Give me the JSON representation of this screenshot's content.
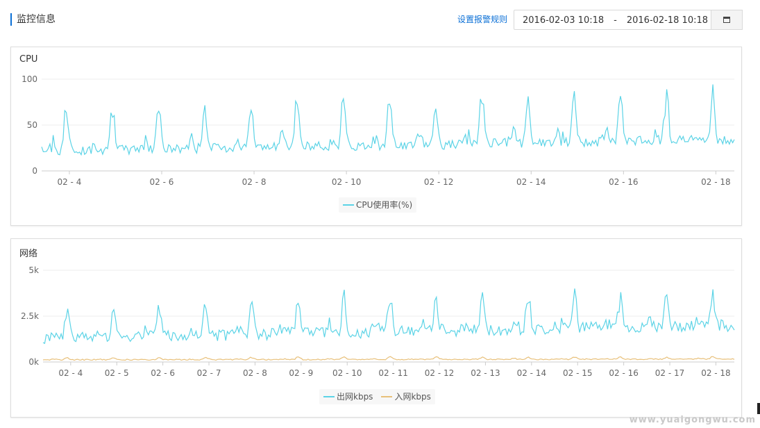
{
  "header": {
    "title": "监控信息",
    "alert_rules_link": "设置报警规则",
    "date_from": "2016-02-03 10:18",
    "date_sep": "-",
    "date_to": "2016-02-18 10:18",
    "calendar_icon": "calendar-icon",
    "accent_color": "#0a6fd6"
  },
  "watermark": "www.yuaigongwu.com",
  "chart_data": [
    {
      "type": "line",
      "title": "CPU",
      "ylim": [
        0,
        100
      ],
      "y_ticks": [
        "0",
        "50",
        "100"
      ],
      "x_range": [
        3.4,
        18.4
      ],
      "x_ticks": [
        {
          "day": 4,
          "label": "02 - 4"
        },
        {
          "day": 6,
          "label": "02 - 6"
        },
        {
          "day": 8,
          "label": "02 - 8"
        },
        {
          "day": 10,
          "label": "02 - 10"
        },
        {
          "day": 12,
          "label": "02 - 12"
        },
        {
          "day": 14,
          "label": "02 - 14"
        },
        {
          "day": 16,
          "label": "02 - 16"
        },
        {
          "day": 18,
          "label": "02 - 18"
        }
      ],
      "grid": true,
      "legend_position": "bottom-center",
      "series": [
        {
          "name": "CPU使用率(%)",
          "color": "#5bd3e6",
          "base": 22,
          "peak": 50,
          "growth": 12
        }
      ]
    },
    {
      "type": "line",
      "title": "网络",
      "ylim": [
        0,
        5000
      ],
      "y_ticks": [
        "0k",
        "2.5k",
        "5k"
      ],
      "x_range": [
        3.4,
        18.4
      ],
      "x_ticks": [
        {
          "day": 4,
          "label": "02 - 4"
        },
        {
          "day": 5,
          "label": "02 - 5"
        },
        {
          "day": 6,
          "label": "02 - 6"
        },
        {
          "day": 7,
          "label": "02 - 7"
        },
        {
          "day": 8,
          "label": "02 - 8"
        },
        {
          "day": 9,
          "label": "02 - 9"
        },
        {
          "day": 10,
          "label": "02 - 10"
        },
        {
          "day": 11,
          "label": "02 - 11"
        },
        {
          "day": 12,
          "label": "02 - 12"
        },
        {
          "day": 13,
          "label": "02 - 13"
        },
        {
          "day": 14,
          "label": "02 - 14"
        },
        {
          "day": 15,
          "label": "02 - 15"
        },
        {
          "day": 16,
          "label": "02 - 16"
        },
        {
          "day": 17,
          "label": "02 - 17"
        },
        {
          "day": 18,
          "label": "02 - 18"
        }
      ],
      "grid": true,
      "legend_position": "bottom-center",
      "series": [
        {
          "name": "出网kbps",
          "color": "#5bd3e6",
          "base": 1300,
          "peak": 1800,
          "growth": 700
        },
        {
          "name": "入网kbps",
          "color": "#e8c07a",
          "base": 120,
          "peak": 120,
          "growth": 40
        }
      ]
    }
  ]
}
